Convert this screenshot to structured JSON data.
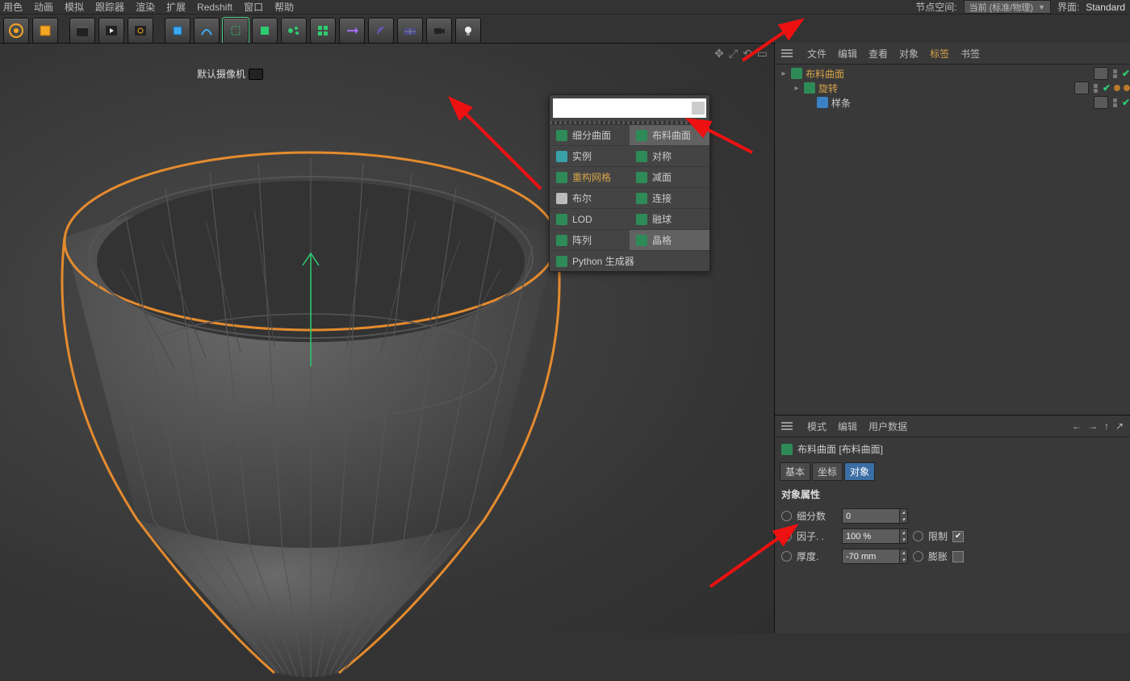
{
  "top_menu": {
    "items": [
      "用色",
      "动画",
      "模拟",
      "跟踪器",
      "渲染",
      "扩展",
      "Redshift",
      "窗口",
      "帮助"
    ]
  },
  "top_right": {
    "node_space_label": "节点空间:",
    "node_space_value": "当前 (标准/物理)",
    "layout_label": "界面:",
    "layout_value": "Standard"
  },
  "viewport": {
    "camera_label": "默认摄像机"
  },
  "popup": {
    "rows": [
      {
        "l": {
          "icon": "#2e8b57",
          "label": "细分曲面"
        },
        "r": {
          "icon": "#2e8b57",
          "label": "布料曲面",
          "hover": true
        }
      },
      {
        "l": {
          "icon": "#39a0a8",
          "label": "实例"
        },
        "r": {
          "icon": "#2e8b57",
          "label": "对称"
        }
      },
      {
        "l": {
          "icon": "#2e8b57",
          "label": "重构网格",
          "orange": true
        },
        "r": {
          "icon": "#2e8b57",
          "label": "减面"
        }
      },
      {
        "l": {
          "icon": "#bbbbbb",
          "label": "布尔"
        },
        "r": {
          "icon": "#2e8b57",
          "label": "连接"
        }
      },
      {
        "l": {
          "icon": "#2e8b57",
          "label": "LOD"
        },
        "r": {
          "icon": "#2e8b57",
          "label": "融球"
        }
      },
      {
        "l": {
          "icon": "#2e8b57",
          "label": "阵列"
        },
        "r": {
          "icon": "#2e8b57",
          "label": "晶格",
          "hover": true
        }
      }
    ],
    "python_label": "Python 生成器"
  },
  "obj_panel": {
    "menu": [
      "文件",
      "编辑",
      "查看",
      "对象",
      "标签",
      "书签"
    ],
    "tree": [
      {
        "indent": 0,
        "icon": "#2e8b57",
        "name": "布料曲面",
        "sel": true,
        "extras": "dots"
      },
      {
        "indent": 1,
        "icon": "#2e8b57",
        "name": "旋转",
        "sel": false,
        "orangeText": true,
        "extras": "balls"
      },
      {
        "indent": 2,
        "icon": "#3b82c4",
        "name": "样条",
        "sel": false,
        "extras": "none"
      }
    ]
  },
  "attr_panel": {
    "menu": [
      "模式",
      "编辑",
      "用户数据"
    ],
    "obj_name": "布料曲面 [布料曲面]",
    "tabs": [
      "基本",
      "坐标",
      "对象"
    ],
    "section": "对象属性",
    "rows": [
      {
        "label": "细分数",
        "value": "0",
        "extra": null
      },
      {
        "label": "因子. .",
        "value": "100 %",
        "extra": {
          "label": "限制",
          "checked": true
        }
      },
      {
        "label": "厚度.",
        "value": "-70 mm",
        "extra": {
          "label": "膨胀",
          "checked": false
        }
      }
    ]
  }
}
